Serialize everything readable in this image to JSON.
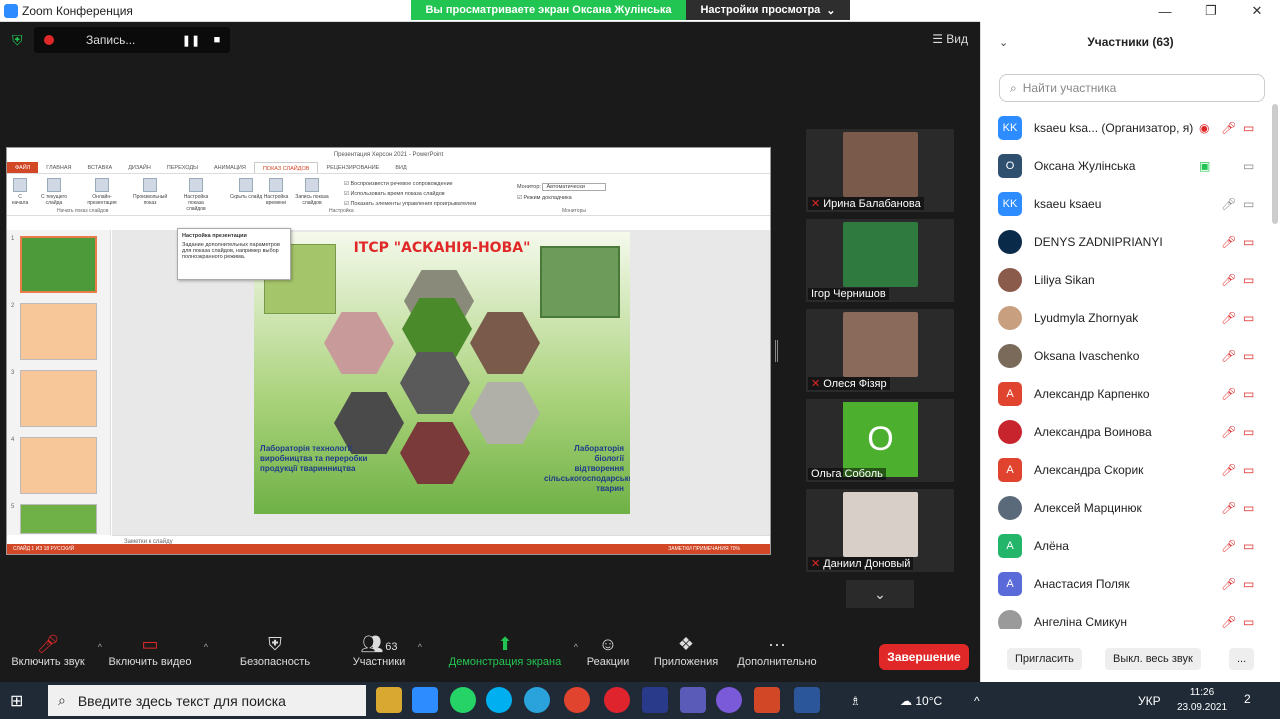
{
  "app": {
    "title": "Zoom Конференция"
  },
  "banner": {
    "sharing": "Вы просматриваете экран Оксана Жулінська",
    "view_settings": "Настройки просмотра"
  },
  "window_controls": {
    "minimize": "—",
    "restore": "❐",
    "close": "✕"
  },
  "recording": {
    "label": "Запись...",
    "pause": "❚❚",
    "stop": "■"
  },
  "view_button": "☰ Вид",
  "ppt": {
    "window_title": "Презентация Херсон 2021 - PowerPoint",
    "tabs": [
      "ФАЙЛ",
      "ГЛАВНАЯ",
      "ВСТАВКА",
      "ДИЗАЙН",
      "ПЕРЕХОДЫ",
      "АНИМАЦИЯ",
      "ПОКАЗ СЛАЙДОВ",
      "РЕЦЕНЗИРОВАНИЕ",
      "ВИД"
    ],
    "ribbon_buttons": [
      "С начала",
      "С текущего слайда",
      "Онлайн-презентация",
      "Произвольный показ",
      "Настройка показа слайдов",
      "Скрыть слайд",
      "Настройка времени",
      "Запись показа слайдов"
    ],
    "checks": [
      "Воспроизвести речевое сопровождение",
      "Использовать время показа слайдов",
      "Показать элементы управления проигрывателем"
    ],
    "monitor_label": "Монитор:",
    "monitor_value": "Автоматически",
    "presenter_view": "Режим докладчика",
    "group_start": "Начать показ слайдов",
    "group_setup": "Настройка",
    "group_monitors": "Мониторы",
    "tooltip_title": "Настройка презентации",
    "tooltip_body": "Задание дополнительных параметров для показа слайдов, например выбор полноэкранного режима.",
    "slide_title": "ІТСР \"АСКАНІЯ-НОВА\"",
    "lab_left": "Лабораторія технології виробництва та переробки продукції тваринництва",
    "lab_right": "Лабораторія біології відтворення сільськогосподарських тварин",
    "notes": "Заметки к слайду",
    "status_left": "СЛАЙД 1 ИЗ 18     РУССКИЙ",
    "status_right": "ЗАМЕТКИ     ПРИМЕЧАНИЯ     70%",
    "thumb_numbers": [
      "1",
      "2",
      "3",
      "4",
      "5"
    ]
  },
  "video_tiles": [
    {
      "name": "Ирина Балабанова",
      "muted": true,
      "color": "#7a5a4a"
    },
    {
      "name": "Ігор Чернишов",
      "muted": false,
      "color": "#2f7a3f"
    },
    {
      "name": "Олеся Фізяр",
      "muted": true,
      "color": "#8a6a5a"
    },
    {
      "name": "Ольга Соболь",
      "muted": false,
      "initial": "О"
    },
    {
      "name": "Даниил Доновый",
      "muted": true,
      "color": "#d8d0c8"
    }
  ],
  "toolbar": {
    "mute": "Включить звук",
    "video": "Включить видео",
    "security": "Безопасность",
    "participants": "Участники",
    "participants_count": "63",
    "share": "Демонстрация экрана",
    "reactions": "Реакции",
    "apps": "Приложения",
    "more": "Дополнительно",
    "end": "Завершение"
  },
  "panel": {
    "title": "Участники (63)",
    "search_placeholder": "Найти участника",
    "invite": "Пригласить",
    "mute_all": "Выкл. весь звук",
    "more": "..."
  },
  "participants": [
    {
      "name": "ksaeu ksa...  (Организатор, я)",
      "avatar": "KK",
      "color": "#2d8cff",
      "mic": "rec",
      "cam": "off"
    },
    {
      "name": "Оксана Жулінська",
      "avatar": "О",
      "color": "#2f4f6f",
      "mic": "share",
      "cam": "grey"
    },
    {
      "name": "ksaeu ksaeu",
      "avatar": "KK",
      "color": "#2d8cff",
      "mic": "grey",
      "cam": "grey"
    },
    {
      "name": "DENYS ZADNIPRIANYI",
      "avatar": "",
      "color": "#0a2a4a",
      "mic": "off",
      "cam": "off"
    },
    {
      "name": "Liliya Sikan",
      "avatar": "",
      "color": "#8a5a4a",
      "mic": "off",
      "cam": "off"
    },
    {
      "name": "Lyudmyla Zhornyak",
      "avatar": "",
      "color": "#c8a080",
      "mic": "off",
      "cam": "off"
    },
    {
      "name": "Oksana Ivaschenko",
      "avatar": "",
      "color": "#7a6a5a",
      "mic": "off",
      "cam": "off"
    },
    {
      "name": "Александр Карпенко",
      "avatar": "A",
      "color": "#e0442e",
      "mic": "off",
      "cam": "off"
    },
    {
      "name": "Александра Воинова",
      "avatar": "",
      "color": "#c8242e",
      "mic": "off",
      "cam": "off"
    },
    {
      "name": "Александра Скорик",
      "avatar": "A",
      "color": "#e0442e",
      "mic": "off",
      "cam": "off"
    },
    {
      "name": "Алексей Марцинюк",
      "avatar": "",
      "color": "#5a6a7a",
      "mic": "off",
      "cam": "off"
    },
    {
      "name": "Алёна",
      "avatar": "A",
      "color": "#23b56a",
      "mic": "off",
      "cam": "off"
    },
    {
      "name": "Анастасия Поляк",
      "avatar": "A",
      "color": "#5a6ad8",
      "mic": "off",
      "cam": "off"
    },
    {
      "name": "Ангеліна Смикун",
      "avatar": "",
      "color": "#9a9a9a",
      "mic": "off",
      "cam": "off"
    }
  ],
  "taskbar": {
    "search_placeholder": "Введите здесь текст для поиска",
    "temperature": "10°C",
    "lang": "УКР",
    "time": "11:26",
    "date": "23.09.2021",
    "notifications": "2"
  }
}
